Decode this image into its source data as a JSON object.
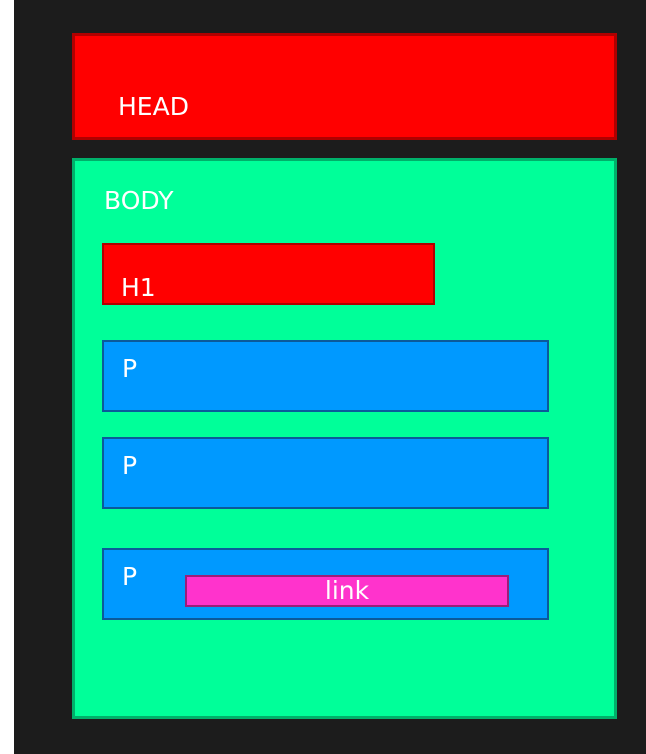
{
  "diagram": {
    "head": {
      "label": "HEAD"
    },
    "body": {
      "label": "BODY",
      "h1": {
        "label": "H1"
      },
      "paragraphs": [
        {
          "label": "P"
        },
        {
          "label": "P"
        },
        {
          "label": "P",
          "link": {
            "label": "link"
          }
        }
      ]
    }
  },
  "colors": {
    "background": "#1c1c1c",
    "head": "#ff0000",
    "body": "#00ff99",
    "h1": "#ff0000",
    "paragraph": "#0099ff",
    "link": "#ff33cc",
    "text": "#ffffff"
  }
}
